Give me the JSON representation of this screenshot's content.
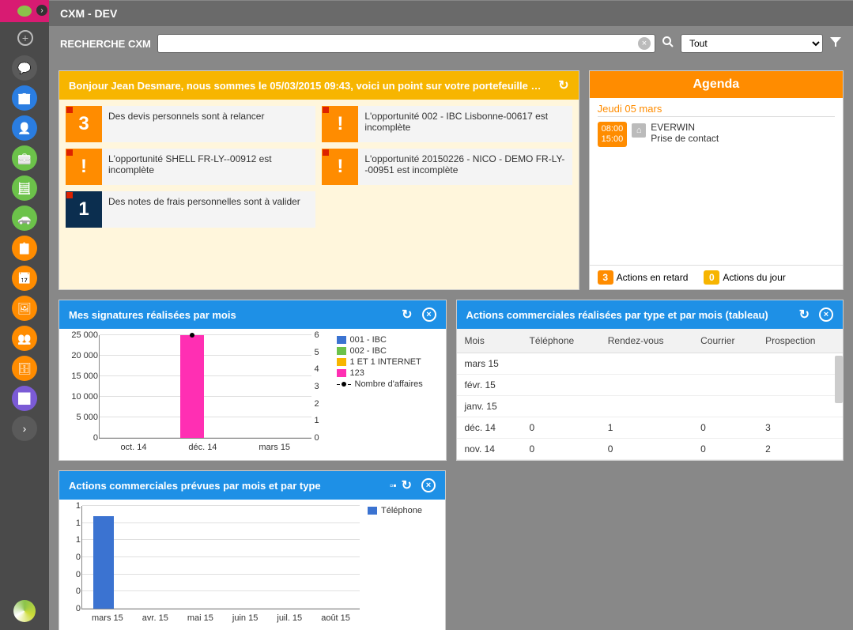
{
  "app": {
    "title": "CXM - DEV"
  },
  "search": {
    "label": "RECHERCHE CXM",
    "placeholder": "",
    "filter_value": "Tout"
  },
  "sidebar_icons": [
    {
      "name": "comment-icon",
      "color": "#5a5a5a",
      "glyph": "💬"
    },
    {
      "name": "building-icon",
      "color": "#2a7de1",
      "glyph": "🏢"
    },
    {
      "name": "user-icon",
      "color": "#2a7de1",
      "glyph": "👤"
    },
    {
      "name": "briefcase-icon",
      "color": "#6cc24a",
      "glyph": "💼"
    },
    {
      "name": "calculator-icon",
      "color": "#6cc24a",
      "glyph": "🧮"
    },
    {
      "name": "car-icon",
      "color": "#6cc24a",
      "glyph": "🚗"
    },
    {
      "name": "calendar-notes-icon",
      "color": "#ff8c00",
      "glyph": "📋"
    },
    {
      "name": "calendar-icon",
      "color": "#ff8c00",
      "glyph": "📅"
    },
    {
      "name": "landscape-icon",
      "color": "#ff8c00",
      "glyph": "🖼"
    },
    {
      "name": "group-icon",
      "color": "#ff8c00",
      "glyph": "👥"
    },
    {
      "name": "drawer-icon",
      "color": "#ff8c00",
      "glyph": "🗄"
    },
    {
      "name": "barchart-icon",
      "color": "#7b5bd6",
      "glyph": "📊"
    },
    {
      "name": "more-icon",
      "color": "#5a5a5a",
      "glyph": "›"
    }
  ],
  "portfolio": {
    "header": "Bonjour Jean Desmare, nous sommes le 05/03/2015 09:43, voici un point sur votre portefeuille …",
    "items": [
      {
        "badge": "3",
        "badge_color": "orange",
        "text": "Des devis personnels sont à relancer"
      },
      {
        "badge": "!",
        "badge_color": "orange",
        "text": "L'opportunité 002 - IBC Lisbonne-00617 est incomplète"
      },
      {
        "badge": "!",
        "badge_color": "orange",
        "text": "L'opportunité SHELL FR-LY--00912 est incomplète"
      },
      {
        "badge": "!",
        "badge_color": "orange",
        "text": "L'opportunité 20150226 - NICO - DEMO FR-LY--00951 est incomplète"
      },
      {
        "badge": "1",
        "badge_color": "navy",
        "text": "Des notes de frais personnelles sont à valider"
      }
    ]
  },
  "agenda": {
    "header": "Agenda",
    "date": "Jeudi 05 mars",
    "items": [
      {
        "start": "08:00",
        "end": "15:00",
        "title": "EVERWIN",
        "subtitle": "Prise de contact"
      }
    ],
    "late_count": "3",
    "late_label": "Actions en retard",
    "today_count": "0",
    "today_label": "Actions du jour"
  },
  "signatures_widget": {
    "title": "Mes signatures réalisées par mois"
  },
  "actions_table_widget": {
    "title": "Actions commerciales réalisées par type et par mois (tableau)",
    "columns": [
      "Mois",
      "Téléphone",
      "Rendez-vous",
      "Courrier",
      "Prospection"
    ],
    "rows": [
      {
        "mois": "mars 15",
        "tel": "",
        "rdv": "",
        "cou": "",
        "pro": ""
      },
      {
        "mois": "févr. 15",
        "tel": "",
        "rdv": "",
        "cou": "",
        "pro": ""
      },
      {
        "mois": "janv. 15",
        "tel": "",
        "rdv": "",
        "cou": "",
        "pro": ""
      },
      {
        "mois": "déc. 14",
        "tel": "0",
        "rdv": "1",
        "cou": "0",
        "pro": "3"
      },
      {
        "mois": "nov. 14",
        "tel": "0",
        "rdv": "0",
        "cou": "0",
        "pro": "2"
      }
    ]
  },
  "planned_widget": {
    "title": "Actions commerciales prévues par mois et par type"
  },
  "chart_data": [
    {
      "id": "signatures",
      "type": "bar",
      "title": "Mes signatures réalisées par mois",
      "categories": [
        "oct. 14",
        "déc. 14",
        "mars 15"
      ],
      "y_left_ticks": [
        "25 000",
        "20 000",
        "15 000",
        "10 000",
        "5 000",
        "0"
      ],
      "y_right_ticks": [
        "6",
        "5",
        "4",
        "3",
        "2",
        "1",
        "0"
      ],
      "ylabel_left": "",
      "ylabel_right": "",
      "series": [
        {
          "name": "001 - IBC",
          "color": "#3b73d1",
          "values": [
            0,
            0,
            0
          ]
        },
        {
          "name": "002 - IBC",
          "color": "#6cc24a",
          "values": [
            0,
            0,
            0
          ]
        },
        {
          "name": "1 ET 1 INTERNET",
          "color": "#f7b500",
          "values": [
            0,
            0,
            0
          ]
        },
        {
          "name": "123",
          "color": "#ff2fb3",
          "values": [
            0,
            25000,
            0
          ]
        }
      ],
      "line_series": {
        "name": "Nombre d'affaires",
        "color": "#000000",
        "values": [
          null,
          6,
          null
        ]
      },
      "ylim_left": [
        0,
        25000
      ],
      "ylim_right": [
        0,
        6
      ]
    },
    {
      "id": "planned",
      "type": "bar",
      "title": "Actions commerciales prévues par mois et par type",
      "categories": [
        "mars 15",
        "avr. 15",
        "mai 15",
        "juin 15",
        "juil. 15",
        "août 15"
      ],
      "y_ticks": [
        "1",
        "1",
        "1",
        "0",
        "0",
        "0",
        "0"
      ],
      "series": [
        {
          "name": "Téléphone",
          "color": "#3b73d1",
          "values": [
            0.9,
            0,
            0,
            0,
            0,
            0
          ]
        }
      ],
      "ylim": [
        0,
        1
      ]
    }
  ]
}
